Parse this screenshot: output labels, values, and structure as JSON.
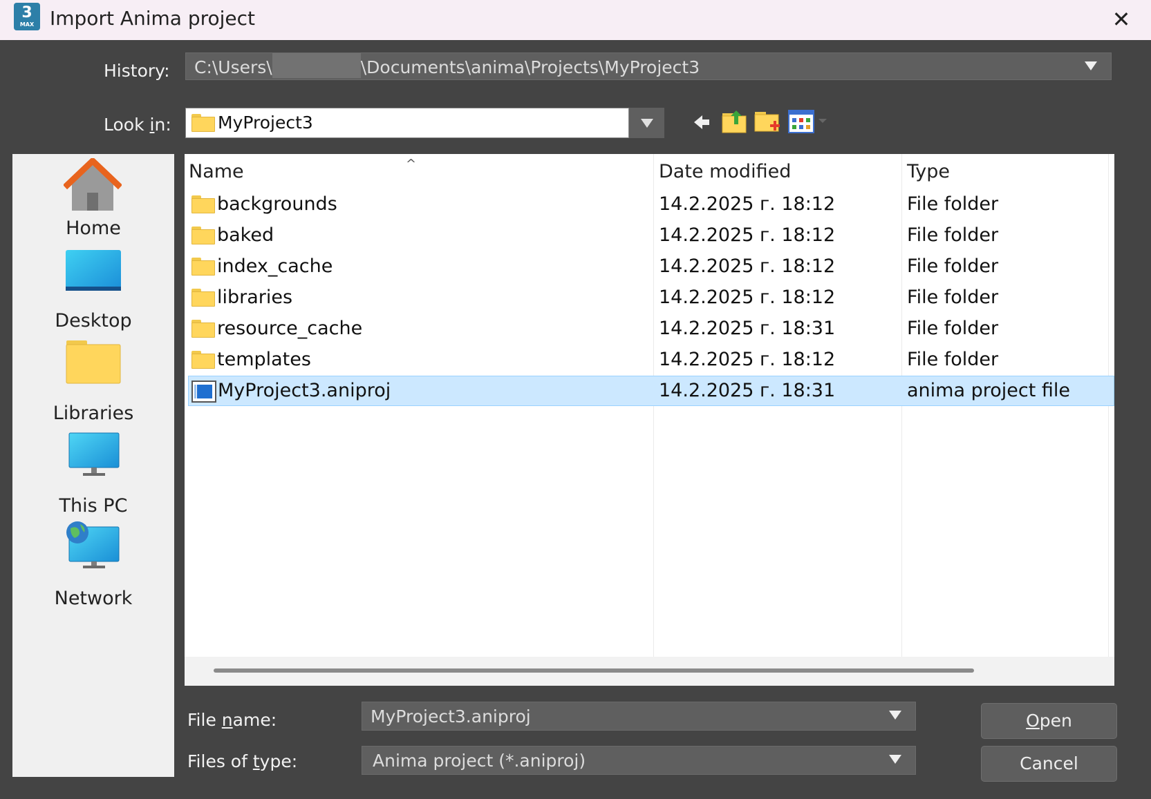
{
  "window": {
    "title": "Import Anima project",
    "app_icon": {
      "label": "3",
      "sublabel": "MAX"
    },
    "close_glyph": "✕"
  },
  "history": {
    "label": "History:",
    "path_prefix": "C:\\Users\\",
    "path_suffix": "\\Documents\\anima\\Projects\\MyProject3"
  },
  "lookin": {
    "label": "Look in:",
    "accel": "i",
    "value": "MyProject3"
  },
  "toolbar": {
    "icons": [
      "back-icon",
      "up-folder-icon",
      "new-folder-icon",
      "view-menu-icon"
    ]
  },
  "places": [
    {
      "label": "Home",
      "icon": "home-icon"
    },
    {
      "label": "Desktop",
      "icon": "desktop-icon"
    },
    {
      "label": "Libraries",
      "icon": "libraries-icon"
    },
    {
      "label": "This PC",
      "icon": "this-pc-icon"
    },
    {
      "label": "Network",
      "icon": "network-icon"
    }
  ],
  "columns": {
    "name": "Name",
    "date": "Date modified",
    "type": "Type",
    "sort_glyph": "^"
  },
  "files": [
    {
      "name": "backgrounds",
      "date": "14.2.2025 г. 18:12",
      "type": "File folder",
      "kind": "folder"
    },
    {
      "name": "baked",
      "date": "14.2.2025 г. 18:12",
      "type": "File folder",
      "kind": "folder"
    },
    {
      "name": "index_cache",
      "date": "14.2.2025 г. 18:12",
      "type": "File folder",
      "kind": "folder"
    },
    {
      "name": "libraries",
      "date": "14.2.2025 г. 18:12",
      "type": "File folder",
      "kind": "folder"
    },
    {
      "name": "resource_cache",
      "date": "14.2.2025 г. 18:31",
      "type": "File folder",
      "kind": "folder"
    },
    {
      "name": "templates",
      "date": "14.2.2025 г. 18:12",
      "type": "File folder",
      "kind": "folder"
    },
    {
      "name": "MyProject3.aniproj",
      "date": "14.2.2025 г. 18:31",
      "type": "anima project file",
      "kind": "file",
      "selected": true
    }
  ],
  "filename": {
    "label_before": "File ",
    "label_accel": "n",
    "label_after": "ame:",
    "value": "MyProject3.aniproj"
  },
  "filetype": {
    "label_before": "Files of ",
    "label_accel": "t",
    "label_after": "ype:",
    "value": "Anima project (*.aniproj)"
  },
  "buttons": {
    "open_accel": "O",
    "open_rest": "pen",
    "cancel": "Cancel"
  },
  "colors": {
    "dialog_bg": "#444444",
    "selection": "#cce8ff",
    "folder": "#ffd65c"
  }
}
